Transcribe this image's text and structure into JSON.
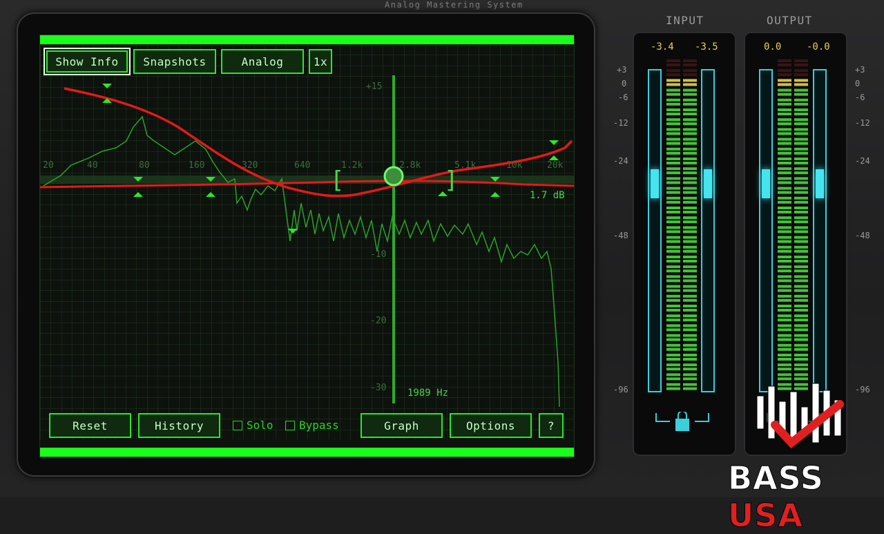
{
  "app": {
    "title": "Analog Mastering System"
  },
  "toolbar": {
    "show_info": "Show Info",
    "snapshots": "Snapshots",
    "analog": "Analog",
    "zoom": "1x"
  },
  "bottom": {
    "reset": "Reset",
    "history": "History",
    "solo": "Solo",
    "bypass": "Bypass",
    "graph": "Graph",
    "options": "Options",
    "help": "?"
  },
  "graph": {
    "freq_labels": [
      "20",
      "40",
      "80",
      "160",
      "320",
      "640",
      "1.2k",
      "2.8k",
      "5.1k",
      "10k",
      "20k"
    ],
    "db_labels": [
      "+15",
      "-10",
      "-20",
      "-30"
    ],
    "cursor_freq": "1989 Hz",
    "gain_readout": "1.7 dB"
  },
  "meters": {
    "input_title": "INPUT",
    "output_title": "OUTPUT",
    "input_peak_l": "-3.4",
    "input_peak_r": "-3.5",
    "output_peak_l": "0.0",
    "output_peak_r": "-0.0",
    "scale": [
      "+3",
      "0",
      "-6",
      "-12",
      "-24",
      "-48",
      "-96"
    ]
  },
  "logo": {
    "word1": "BASS",
    "word2": "USA"
  },
  "colors": {
    "screen_green": "#19ff19",
    "curve_red": "#e21a1a",
    "meter_cyan": "#39d0dc",
    "peak_yellow": "#e6d24b"
  }
}
